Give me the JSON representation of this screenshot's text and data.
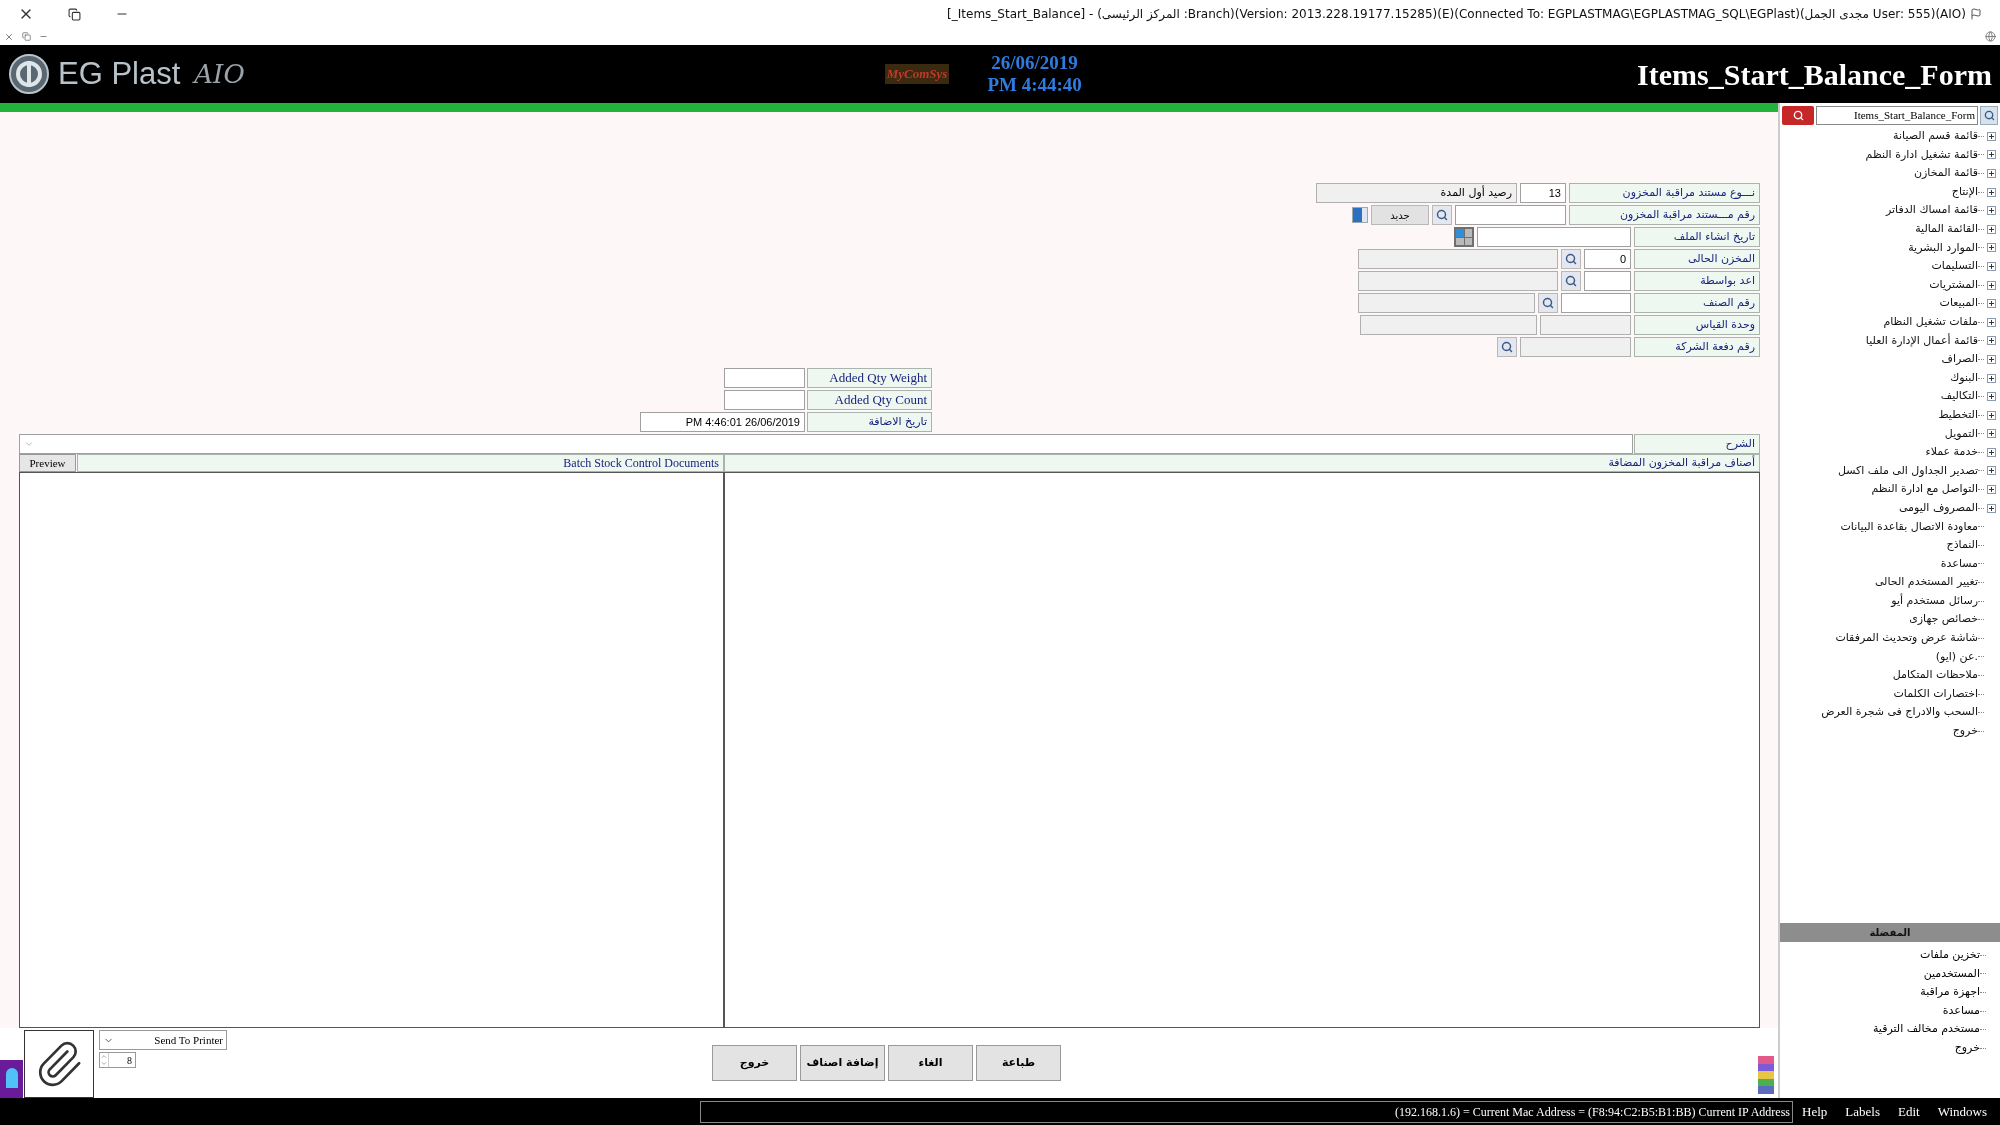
{
  "window": {
    "title": "[_Items_Start_Balance] - (المركز الرئيسى :Branch)(Version: 2013.228.19177.15285)(E)(Connected To: EGPLASTMAG\\EGPLASTMAG_SQL\\EGPlast)(مجدى الجمل User: 555)(AIO)"
  },
  "header": {
    "logo_text": "EG Plast",
    "logo_script": "AIO",
    "brand": "MyComSys",
    "date": "26/06/2019",
    "time": "PM 4:44:40",
    "form_title": "Items_Start_Balance_Form"
  },
  "form": {
    "fields": [
      {
        "kind": "type",
        "label": "نـــوع مستند مراقبة المخزون",
        "value": "13",
        "text": "رصيد أول المدة"
      },
      {
        "kind": "number",
        "label": "رقم مـــستند مراقبة المخزون",
        "button": "جديد"
      },
      {
        "kind": "date",
        "label": "تاريخ انشاء الملف"
      },
      {
        "kind": "store",
        "label": "المخزن الحالى",
        "value": "0"
      },
      {
        "kind": "store",
        "label": "اعد بواسطة"
      },
      {
        "kind": "item",
        "label": "رقم الصنف"
      },
      {
        "kind": "unit",
        "label": "وحدة القياس"
      },
      {
        "kind": "batch",
        "label": "رقم دفعة الشركة"
      }
    ]
  },
  "added": [
    {
      "kind": "number",
      "label": "Added Qty Weight"
    },
    {
      "kind": "number",
      "label": "Added Qty Count"
    },
    {
      "kind": "datetime",
      "label": "تاريخ الاضافة",
      "value": "PM 4:46:01 26/06/2019"
    }
  ],
  "description": {
    "label": "الشرح"
  },
  "documents_panel": {
    "button": "Preview",
    "title": "Batch Stock Control Documents"
  },
  "items_panel": {
    "title": "أصناف مراقبة المخزون المضافة"
  },
  "printer": {
    "value": "Send To Printer",
    "copies": "8"
  },
  "buttons": [
    "طباعة",
    "الغاء",
    "إضافة اصناف",
    "خروج"
  ],
  "sidebar": {
    "search": {
      "value": "Items_Start_Balance_Form"
    },
    "tree": [
      {
        "label": "قائمة قسم الصيانة",
        "expandable": true
      },
      {
        "label": "قائمة تشغيل ادارة النظم",
        "expandable": true
      },
      {
        "label": "قائمة المخازن",
        "expandable": true
      },
      {
        "label": "الإنتاج",
        "expandable": true
      },
      {
        "label": "قائمة امساك الدفاتر",
        "expandable": true
      },
      {
        "label": "القائمة المالية",
        "expandable": true
      },
      {
        "label": "الموارد البشرية",
        "expandable": true
      },
      {
        "label": "التسليمات",
        "expandable": true
      },
      {
        "label": "المشتريات",
        "expandable": true
      },
      {
        "label": "المبيعات",
        "expandable": true
      },
      {
        "label": "ملفات تشغيل النظام",
        "expandable": true
      },
      {
        "label": "قائمة أعمال الإدارة العليا",
        "expandable": true
      },
      {
        "label": "الصراف",
        "expandable": true
      },
      {
        "label": "البنوك",
        "expandable": true
      },
      {
        "label": "التكاليف",
        "expandable": true
      },
      {
        "label": "التخطيط",
        "expandable": true
      },
      {
        "label": "التمويل",
        "expandable": true
      },
      {
        "label": "خدمة عملاء",
        "expandable": true
      },
      {
        "label": "تصدير الجداول الى ملف اكسل",
        "expandable": true
      },
      {
        "label": "التواصل مع ادارة النظم",
        "expandable": true
      },
      {
        "label": "المصروف اليومى",
        "expandable": true
      },
      {
        "label": "معاودة الاتصال بقاعدة البيانات",
        "expandable": false
      },
      {
        "label": "النماذج",
        "expandable": false
      },
      {
        "label": "مساعدة",
        "expandable": false
      },
      {
        "label": "تغيير المستخدم الحالى",
        "expandable": false
      },
      {
        "label": "رسائل مستخدم أيو",
        "expandable": false
      },
      {
        "label": "خصائص جهازى",
        "expandable": false
      },
      {
        "label": "شاشة عرض وتحديث المرفقات",
        "expandable": false
      },
      {
        "label": "عن (ايو).",
        "expandable": false
      },
      {
        "label": "ملاحظات المتكامل",
        "expandable": false
      },
      {
        "label": "اختصارات الكلمات",
        "expandable": false
      },
      {
        "label": "السحب والادراج فى شجرة العرض",
        "expandable": false
      },
      {
        "label": "خروج",
        "expandable": false
      }
    ],
    "favorites": {
      "title": "المفضلة",
      "items": [
        "تخزين ملفات",
        "المستخدمين",
        "اجهزة مراقبة",
        "مساعدة",
        "مستخدم مخالف الترقية",
        "خروج"
      ]
    }
  },
  "status_bar": {
    "info": "(192.168.1.6) = Current Mac Address = (F8:94:C2:B5:B1:BB) Current IP Address",
    "menus": [
      "Windows",
      "Edit",
      "Labels",
      "Help"
    ]
  }
}
